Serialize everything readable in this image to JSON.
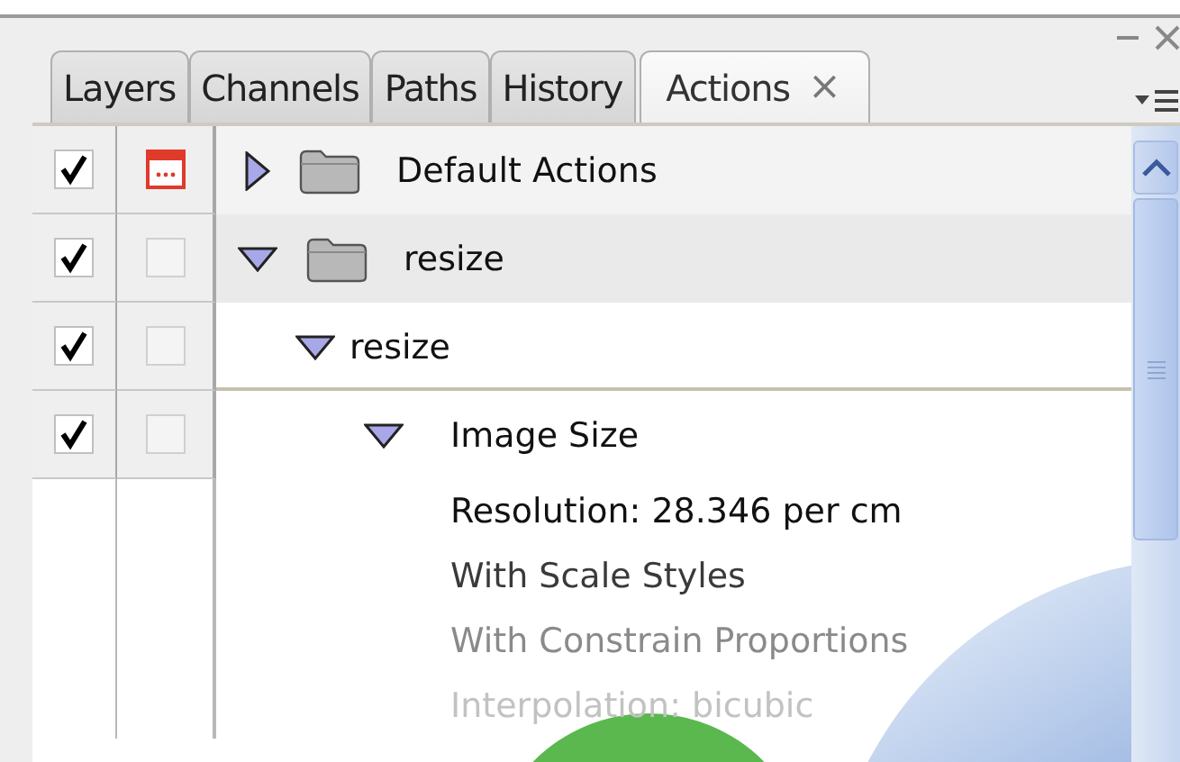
{
  "tabs": [
    {
      "label": "Layers",
      "selected": false
    },
    {
      "label": "Channels",
      "selected": false
    },
    {
      "label": "Paths",
      "selected": false
    },
    {
      "label": "History",
      "selected": false
    },
    {
      "label": "Actions",
      "selected": true,
      "close": "×"
    }
  ],
  "actions": [
    {
      "kind": "set",
      "name": "Default Actions",
      "checked": true,
      "dialog": true,
      "expanded": false
    },
    {
      "kind": "set",
      "name": "resize",
      "checked": true,
      "dialog": false,
      "expanded": true,
      "children": [
        {
          "kind": "action",
          "name": "resize",
          "checked": true,
          "dialog": false,
          "expanded": true,
          "children": [
            {
              "kind": "step",
              "name": "Image Size",
              "checked": true,
              "dialog": false,
              "expanded": true,
              "details": [
                "Resolution: 28.346 per cm",
                "With Scale Styles",
                "With Constrain Proportions",
                "Interpolation: bicubic"
              ]
            }
          ]
        }
      ]
    }
  ]
}
